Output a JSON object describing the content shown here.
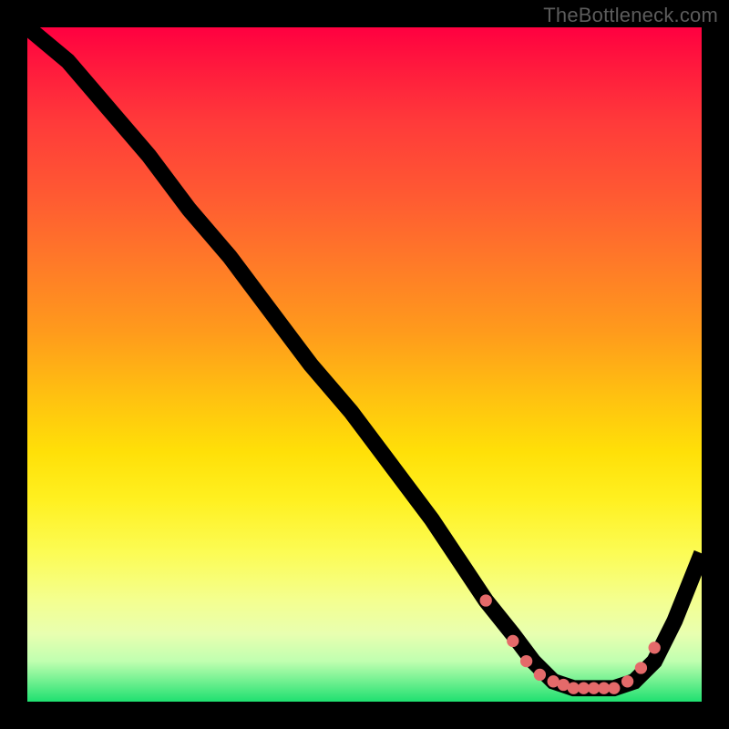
{
  "watermark": "TheBottleneck.com",
  "chart_data": {
    "type": "line",
    "title": "",
    "xlabel": "",
    "ylabel": "",
    "xlim": [
      0,
      100
    ],
    "ylim": [
      0,
      100
    ],
    "series": [
      {
        "name": "curve",
        "x": [
          0,
          6,
          12,
          18,
          24,
          30,
          36,
          42,
          48,
          54,
          60,
          64,
          68,
          72,
          75,
          78,
          81,
          84,
          87,
          90,
          93,
          96,
          100
        ],
        "y": [
          100,
          95,
          88,
          81,
          73,
          66,
          58,
          50,
          43,
          35,
          27,
          21,
          15,
          10,
          6,
          3,
          2,
          2,
          2,
          3,
          6,
          12,
          22
        ]
      }
    ],
    "highlight_dots": {
      "x": [
        68,
        72,
        74,
        76,
        78,
        79.5,
        81,
        82.5,
        84,
        85.5,
        87,
        89,
        91,
        93
      ],
      "y": [
        15,
        9,
        6,
        4,
        3,
        2.5,
        2,
        2,
        2,
        2,
        2,
        3,
        5,
        8
      ]
    },
    "colors": {
      "curve": "#000000",
      "dots": "#e46a6a",
      "gradient_top": "#ff0040",
      "gradient_mid": "#ffe008",
      "gradient_bottom": "#1fe070",
      "background": "#000000",
      "watermark": "#5c5c5c"
    }
  }
}
